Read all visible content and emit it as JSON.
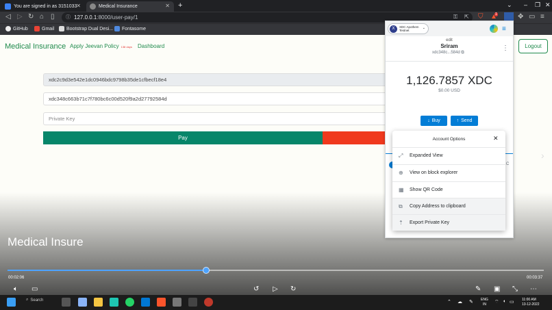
{
  "browser": {
    "tabs": [
      {
        "title": "You are signed in as 3151033",
        "icon": "tab-favicon-blue"
      },
      {
        "title": "Medical Insurance",
        "icon": "globe-icon"
      }
    ],
    "url_host": "127.0.0.1",
    "url_rest": ":8000/user-pay/1",
    "bookmarks": [
      {
        "label": "GitHub",
        "icon": "github-icon"
      },
      {
        "label": "Gmail",
        "icon": "gmail-icon"
      },
      {
        "label": "Bootstrap Dual Desi...",
        "icon": "bootstrap-icon"
      },
      {
        "label": "Fontasome",
        "icon": "flag-icon"
      }
    ],
    "extension_badge": "1"
  },
  "app": {
    "brand": "Medical Insurance",
    "nav": [
      {
        "label": "Apply Jeevan Policy",
        "badge": "138 days"
      },
      {
        "label": "Dashboard"
      }
    ],
    "logout_label": "Logout",
    "form": {
      "to_address": "xdc2c9d3e542e1dc0946bdc9798b35de1cfbecf18e4",
      "from_address": "xdc348c663b71c7f780bc6c00d520f9a2d27792584d",
      "private_key_placeholder": "Private Key",
      "pay_label": "Pay"
    },
    "colors": {
      "brand_green": "#1f8a4c",
      "pay_green": "#07866a",
      "red": "#f0391e"
    }
  },
  "video": {
    "title": "Medical Insure",
    "current_time": "00:02:06",
    "duration": "00:03:37",
    "progress_fraction": 0.37
  },
  "wallet": {
    "network_line1": "XDC Apothem",
    "network_line2": "Testnet",
    "edit_label": "edit",
    "account_name": "Sriram",
    "short_address": "xdc348c...584d",
    "balance": "1,126.7857 XDC",
    "fiat": "$0.00 USD",
    "buy_label": "Buy",
    "send_label": "Send",
    "peek_letter": "C"
  },
  "account_options": {
    "title": "Account Options",
    "items": [
      {
        "label": "Expanded View",
        "icon": "expand-icon"
      },
      {
        "label": "View on block explorer",
        "icon": "explorer-icon"
      },
      {
        "label": "Show QR Code",
        "icon": "qr-code-icon"
      },
      {
        "label": "Copy Address to clipboard",
        "icon": "copy-icon"
      },
      {
        "label": "Export Private Key",
        "icon": "key-export-icon"
      }
    ]
  },
  "taskbar": {
    "search_label": "Search",
    "lang_line1": "ENG",
    "lang_line2": "IN",
    "clock_time": "11:00 AM",
    "clock_date": "13-12-2022"
  }
}
